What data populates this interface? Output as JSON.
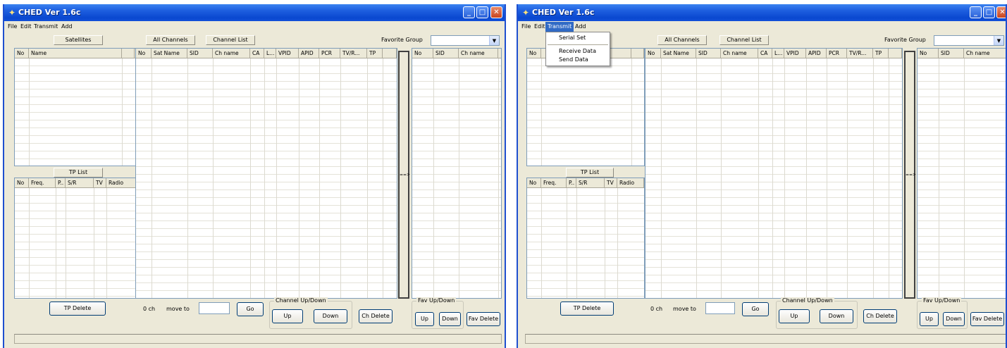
{
  "app": {
    "title": "CHED Ver 1.6c"
  },
  "menu": [
    "File",
    "Edit",
    "Transmit",
    "Add"
  ],
  "transmit_menu": [
    "Serial Set",
    "Receive Data",
    "Send Data"
  ],
  "labels": {
    "satellites": "Satellites",
    "all_channels": "All Channels",
    "channel_list": "Channel List",
    "favorite_group": "Favorite Group",
    "tp_list": "TP List",
    "arrow": "==>"
  },
  "satellite_columns": [
    "No",
    "Name"
  ],
  "channel_columns": [
    "No",
    "Sat Name",
    "SID",
    "Ch name",
    "CA",
    "L...",
    "VPID",
    "APID",
    "PCR",
    "TV/R...",
    "TP"
  ],
  "favorite_columns": [
    "No",
    "SID",
    "Ch name"
  ],
  "tp_columns": [
    "No",
    "Freq.",
    "P..",
    "S/R",
    "TV",
    "Radio"
  ],
  "bottom": {
    "tp_delete": "TP Delete",
    "ch_count": "0 ch",
    "move_to": "move to",
    "go": "Go",
    "channel_updown": "Channel Up/Down",
    "up": "Up",
    "down": "Down",
    "ch_delete": "Ch Delete",
    "fav_updown": "Fav Up/Down",
    "fav_delete": "Fav Delete"
  }
}
